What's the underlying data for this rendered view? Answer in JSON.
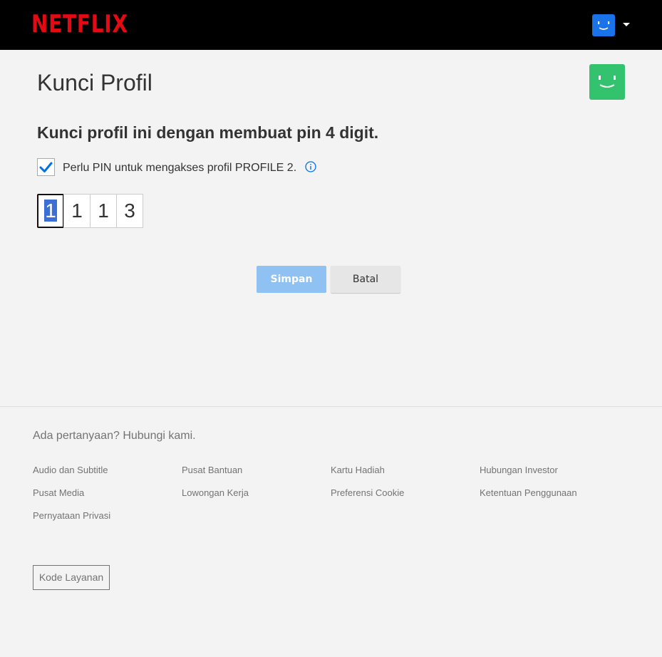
{
  "header": {
    "logo_text": "NETFLIX",
    "brand_color": "#e50914",
    "avatar_icon": "smiley-avatar-icon",
    "avatar_color": "#1a73e8"
  },
  "main": {
    "title": "Kunci Profil",
    "profile_avatar_color": "#33c36f",
    "subheading": "Kunci profil ini dengan membuat pin 4 digit.",
    "require_pin": {
      "checked": true,
      "label": "Perlu PIN untuk mengakses profil PROFILE 2."
    },
    "pin_digits": [
      "1",
      "1",
      "1",
      "3"
    ],
    "save_label": "Simpan",
    "cancel_label": "Batal"
  },
  "footer": {
    "question": "Ada pertanyaan? Hubungi kami.",
    "links": [
      "Audio dan Subtitle",
      "Pusat Bantuan",
      "Kartu Hadiah",
      "Hubungan Investor",
      "Pusat Media",
      "Lowongan Kerja",
      "Preferensi Cookie",
      "Ketentuan Penggunaan",
      "Pernyataan Privasi"
    ],
    "service_code_label": "Kode Layanan"
  }
}
